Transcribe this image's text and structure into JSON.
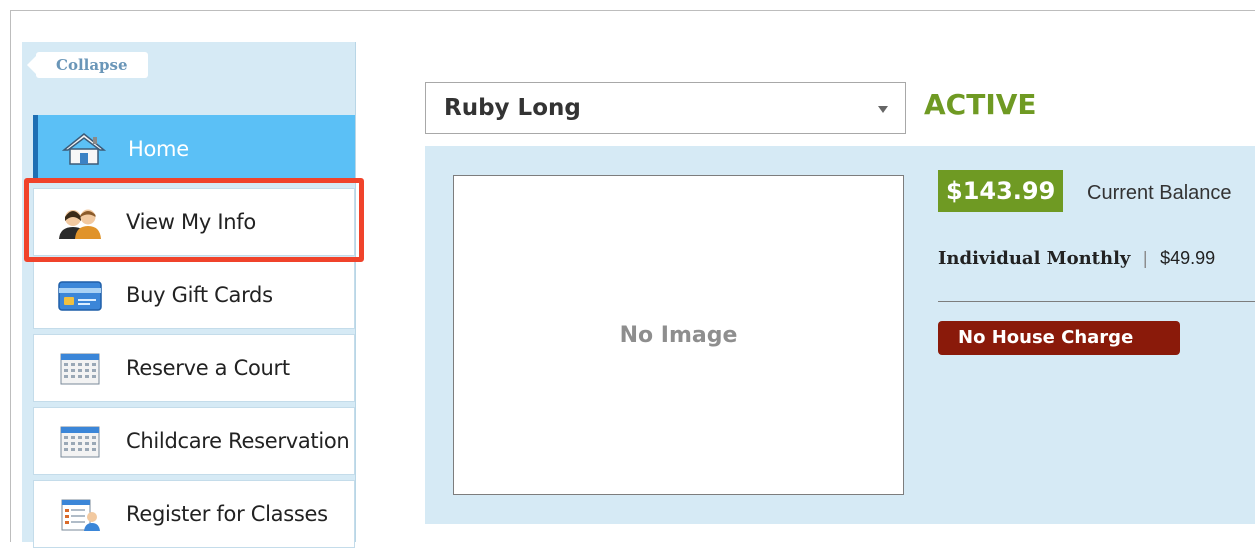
{
  "sidebar": {
    "collapse_label": "Collapse",
    "items": [
      {
        "label": "Home",
        "icon": "home-icon"
      },
      {
        "label": "View My Info",
        "icon": "users-icon"
      },
      {
        "label": "Buy Gift Cards",
        "icon": "gift-card-icon"
      },
      {
        "label": "Reserve a Court",
        "icon": "calendar-icon"
      },
      {
        "label": "Childcare Reservation",
        "icon": "calendar-icon"
      },
      {
        "label": "Register for Classes",
        "icon": "register-icon"
      }
    ]
  },
  "member": {
    "selected": "Ruby Long",
    "status": "ACTIVE"
  },
  "profile": {
    "no_image": "No Image",
    "balance": "$143.99",
    "balance_label": "Current Balance",
    "plan": "Individual Monthly",
    "plan_separator": "|",
    "plan_price": "$49.99",
    "house_charge": "No House Charge"
  },
  "colors": {
    "accent_green": "#6f9a23",
    "active_blue": "#5bc0f6",
    "highlight_red": "#f0432b",
    "badge_red": "#8a1a0a"
  }
}
